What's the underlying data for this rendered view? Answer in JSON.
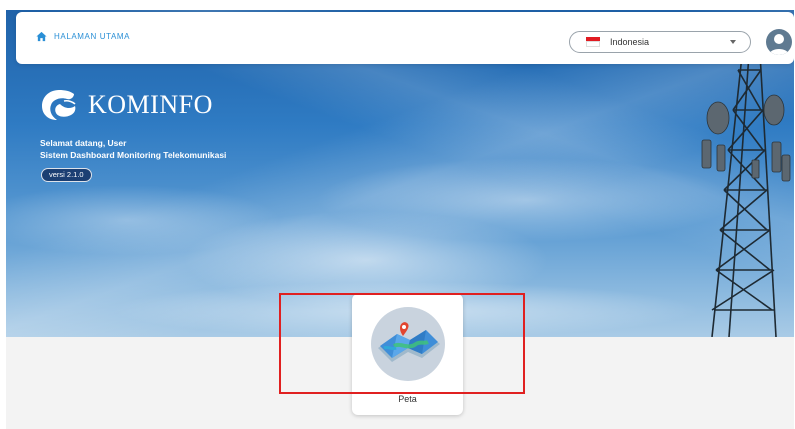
{
  "header": {
    "home_label": "HALAMAN UTAMA",
    "language": {
      "selected": "Indonesia",
      "flag_colors": [
        "#e11b22",
        "#ffffff"
      ]
    },
    "avatar_icon": "user-avatar-icon"
  },
  "hero": {
    "brand_name": "KOMINFO",
    "welcome_line": "Selamat datang, User",
    "subtitle": "Sistem Dashboard Monitoring Telekomunikasi",
    "version": "versi 2.1.0"
  },
  "menu": {
    "cards": [
      {
        "label": "Peta",
        "icon": "map-icon"
      }
    ]
  },
  "colors": {
    "accent": "#2a8fd6",
    "badge_bg": "#1b3f73",
    "highlight": "#e02020"
  }
}
